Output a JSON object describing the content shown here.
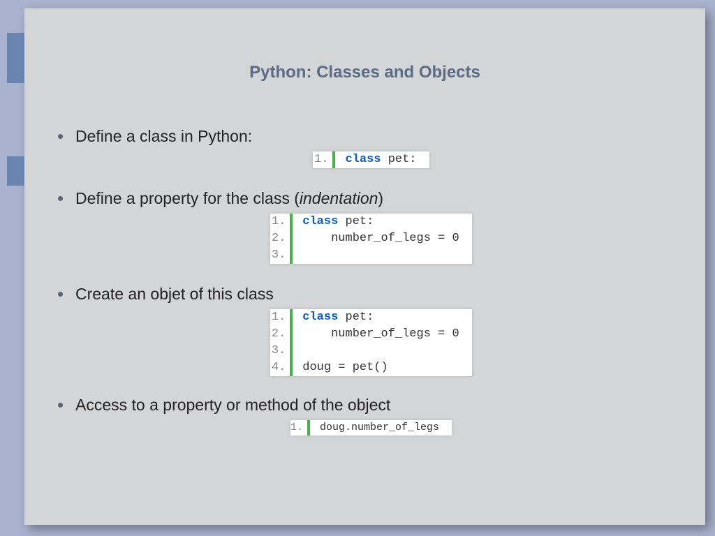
{
  "title": "Python: Classes and Objects",
  "bullets": {
    "b1": "Define a class in Python:",
    "b2a": "Define a property for the class (",
    "b2b": "indentation",
    "b2c": ")",
    "b3": "Create an objet of this class",
    "b4": " Access to a property or method of the object"
  },
  "code1": {
    "ln1": "1.",
    "kw": "class",
    "id": " pet:"
  },
  "code2": {
    "ln1": "1.",
    "ln2": "2.",
    "ln3": "3.",
    "kw": "class",
    "id": " pet:",
    "l2": "    number_of_legs = 0"
  },
  "code3": {
    "ln1": "1.",
    "ln2": "2.",
    "ln3": "3.",
    "ln4": "4.",
    "kw": "class",
    "id": " pet:",
    "l2": "    number_of_legs = 0",
    "l4": "doug = pet()"
  },
  "code4": {
    "ln1": "1.",
    "l1": "doug.number_of_legs"
  }
}
